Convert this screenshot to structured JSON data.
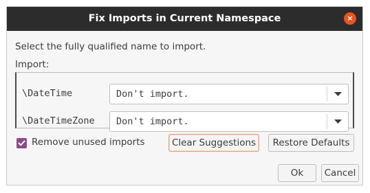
{
  "window": {
    "title": "Fix Imports in Current Namespace",
    "close_glyph": "×"
  },
  "instruction": "Select the fully qualified name to import.",
  "import_label": "Import:",
  "imports": [
    {
      "name": "\\DateTime",
      "selected": "Don't import."
    },
    {
      "name": "\\DateTimeZone",
      "selected": "Don't import."
    }
  ],
  "options": {
    "remove_unused_label": "Remove unused imports",
    "remove_unused_checked": true
  },
  "buttons": {
    "clear_suggestions": "Clear Suggestions",
    "restore_defaults": "Restore Defaults",
    "ok": "Ok",
    "cancel": "Cancel"
  },
  "colors": {
    "titlebar": "#2c2c2c",
    "close_button": "#e95420",
    "checkbox": "#8c4b86"
  },
  "icons": {
    "close": "close-icon",
    "dropdown": "chevron-down-icon",
    "check": "checkmark-icon"
  }
}
